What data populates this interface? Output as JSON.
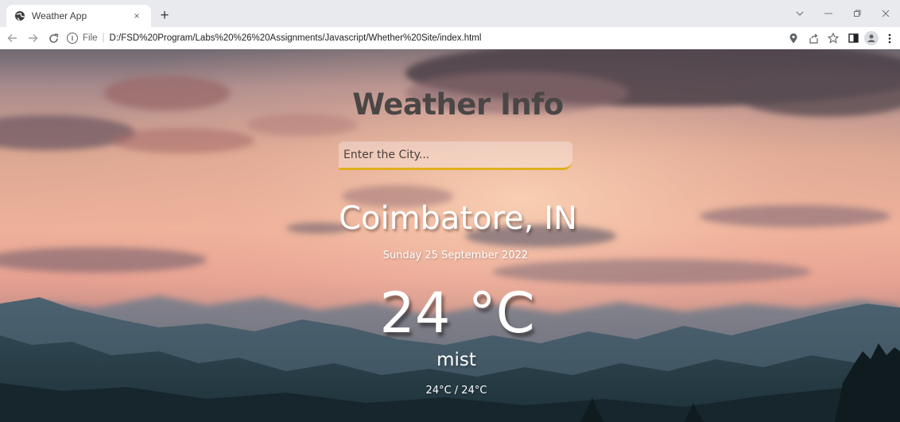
{
  "browser": {
    "tab_title": "Weather App",
    "tab_close": "×",
    "new_tab": "+",
    "file_label": "File",
    "url": "D:/FSD%20Program/Labs%20%26%20Assignments/Javascript/Whether%20Site/index.html",
    "icons": {
      "tab_favicon": "globe-icon",
      "back": "back-arrow-icon",
      "forward": "forward-arrow-icon",
      "reload": "reload-icon",
      "site_info": "info-icon",
      "location": "location-pin-icon",
      "share": "share-icon",
      "bookmark": "star-icon",
      "side_panel": "side-panel-icon",
      "profile": "profile-icon",
      "menu": "kebab-menu-icon"
    }
  },
  "weather": {
    "heading": "Weather Info",
    "search_placeholder": "Enter the City...",
    "city": "Coimbatore, IN",
    "date": "Sunday 25 September 2022",
    "temperature": "24 °C",
    "condition": "mist",
    "hi_low": "24°C / 24°C"
  },
  "colors": {
    "heading": "#4a4646",
    "search_underline": "#e0b01b",
    "text": "#ffffff"
  }
}
